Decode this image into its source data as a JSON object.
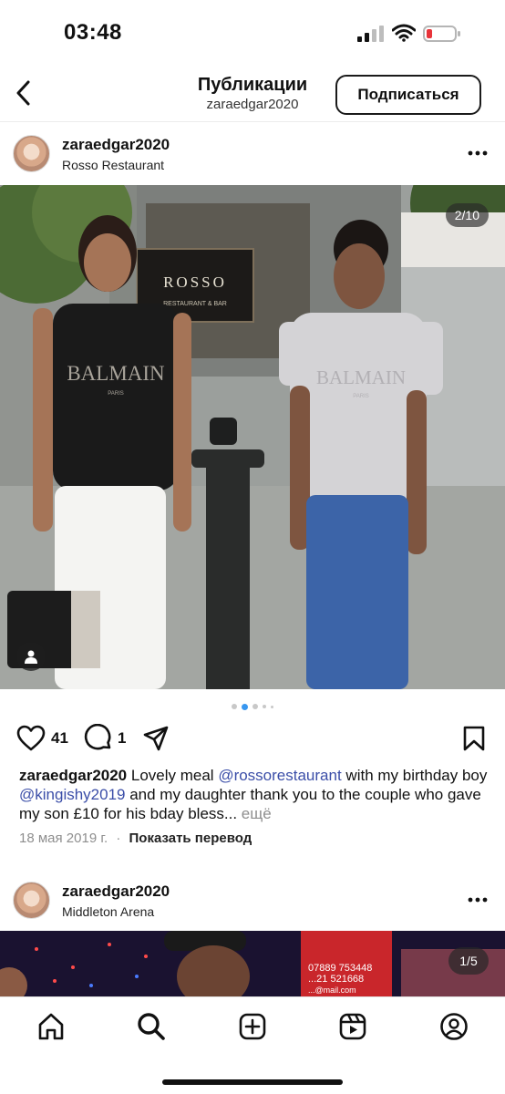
{
  "status_bar": {
    "time": "03:48"
  },
  "header": {
    "back_icon": "chevron-left-icon",
    "title": "Публикации",
    "subtitle": "zaraedgar2020",
    "follow_label": "Подписаться"
  },
  "post1": {
    "username": "zaraedgar2020",
    "location": "Rosso Restaurant",
    "image_counter": "2/10",
    "likes": "41",
    "comments": "1",
    "caption": {
      "username": "zaraedgar2020",
      "text_1": " Lovely meal ",
      "mention_1": "@rossorestaurant",
      "text_2": " with my birthday boy ",
      "mention_2": "@kingishy2019",
      "text_3": " and my daughter thank you to the couple who gave my son £10 for his bday bless... ",
      "more": "ещё"
    },
    "date": "18 мая 2019 г.",
    "separator": "·",
    "translate": "Показать перевод",
    "photo_sign": {
      "brand": "ROSSO",
      "tagline": "RESTAURANT & BAR"
    },
    "shirt_text": {
      "brand": "BALMAIN",
      "city": "PARIS"
    }
  },
  "post2": {
    "username": "zaraedgar2020",
    "location": "Middleton Arena",
    "image_counter": "1/5",
    "photo_text": {
      "line_1": "07889 753448",
      "line_2": "...21 521668",
      "line_3": "...@mail.com"
    }
  },
  "tab_bar": {
    "items": [
      "home-icon",
      "search-icon",
      "create-post-icon",
      "reels-icon",
      "profile-icon"
    ]
  },
  "colors": {
    "mention": "#3b4ea8",
    "muted": "#8e8e8e",
    "active_dot": "#3897f0",
    "battery_low": "#e8343a"
  }
}
